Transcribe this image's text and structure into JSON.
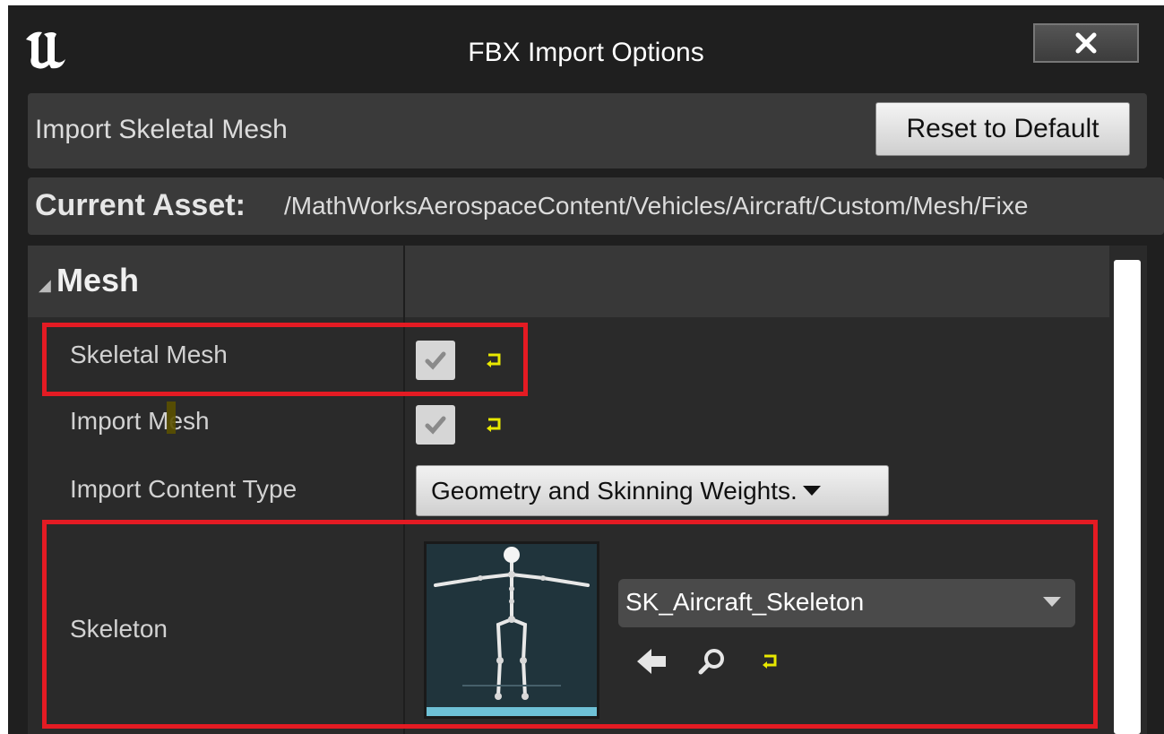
{
  "window": {
    "title": "FBX Import Options",
    "logo_icon": "unreal-engine-logo",
    "close_icon": "close-icon"
  },
  "header": {
    "title": "Import Skeletal Mesh",
    "reset_label": "Reset to Default"
  },
  "current_asset": {
    "label": "Current Asset:",
    "path": "/MathWorksAerospaceContent/Vehicles/Aircraft/Custom/Mesh/Fixe"
  },
  "section": {
    "name": "Mesh",
    "properties": {
      "skeletal_mesh": {
        "label": "Skeletal Mesh",
        "checked": true
      },
      "import_mesh": {
        "label": "Import Mesh",
        "checked": true
      },
      "import_content_type": {
        "label": "Import Content Type",
        "value": "Geometry and Skinning Weights."
      },
      "skeleton": {
        "label": "Skeleton",
        "value": "SK_Aircraft_Skeleton"
      }
    }
  },
  "colors": {
    "highlight": "#e41b23",
    "reset_arrow": "#e8e800",
    "background": "#1f1f1f"
  }
}
